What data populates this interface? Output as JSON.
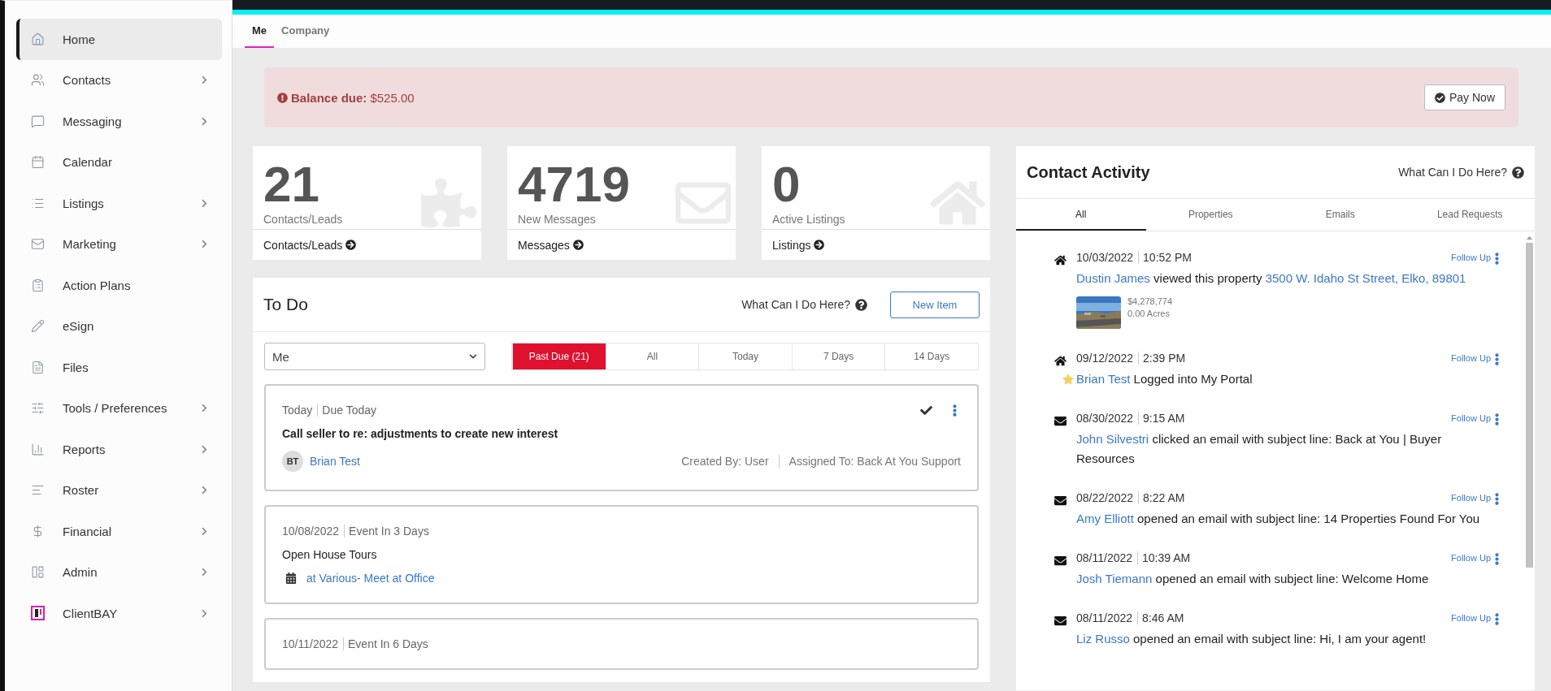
{
  "sidebar": {
    "items": [
      {
        "label": "Home",
        "selected": true,
        "has_submenu": false
      },
      {
        "label": "Contacts",
        "selected": false,
        "has_submenu": true
      },
      {
        "label": "Messaging",
        "selected": false,
        "has_submenu": true
      },
      {
        "label": "Calendar",
        "selected": false,
        "has_submenu": false
      },
      {
        "label": "Listings",
        "selected": false,
        "has_submenu": true
      },
      {
        "label": "Marketing",
        "selected": false,
        "has_submenu": true
      },
      {
        "label": "Action Plans",
        "selected": false,
        "has_submenu": false
      },
      {
        "label": "eSign",
        "selected": false,
        "has_submenu": false
      },
      {
        "label": "Files",
        "selected": false,
        "has_submenu": false
      },
      {
        "label": "Tools / Preferences",
        "selected": false,
        "has_submenu": true
      },
      {
        "label": "Reports",
        "selected": false,
        "has_submenu": true
      },
      {
        "label": "Roster",
        "selected": false,
        "has_submenu": true
      },
      {
        "label": "Financial",
        "selected": false,
        "has_submenu": true
      },
      {
        "label": "Admin",
        "selected": false,
        "has_submenu": true
      },
      {
        "label": "ClientBAY",
        "selected": false,
        "has_submenu": true
      }
    ]
  },
  "top_tabs": [
    {
      "label": "Me",
      "selected": true
    },
    {
      "label": "Company",
      "selected": false
    }
  ],
  "balance_banner": {
    "label": "Balance due:",
    "amount": "$525.00",
    "button": "Pay Now"
  },
  "stats": [
    {
      "kind": "puzzle",
      "value": "21",
      "label": "Contacts/Leads",
      "link": "Contacts/Leads"
    },
    {
      "kind": "mail",
      "value": "4719",
      "label": "New Messages",
      "link": "Messages"
    },
    {
      "kind": "house",
      "value": "0",
      "label": "Active Listings",
      "link": "Listings"
    }
  ],
  "todo": {
    "title": "To Do",
    "help": "What Can I Do Here?",
    "new_button": "New Item",
    "assignee": "Me",
    "filters": [
      {
        "label": "Past Due (21)",
        "selected": true
      },
      {
        "label": "All",
        "selected": false
      },
      {
        "label": "Today",
        "selected": false
      },
      {
        "label": "7 Days",
        "selected": false
      },
      {
        "label": "14 Days",
        "selected": false
      }
    ],
    "items": [
      {
        "kind": "task",
        "date": "Today",
        "status": "Due Today",
        "title": "Call seller to re: adjustments to create new interest",
        "contact_initials": "BT",
        "contact": "Brian Test",
        "created_by": "Created By: User",
        "assigned_to": "Assigned To: Back At You Support"
      },
      {
        "kind": "event",
        "date": "10/08/2022",
        "status": "Event In 3 Days",
        "title": "Open House Tours",
        "location": "at Various- Meet at Office"
      },
      {
        "kind": "event",
        "date": "10/11/2022",
        "status": "Event In 6 Days"
      }
    ]
  },
  "contact_activity": {
    "title": "Contact Activity",
    "help": "What Can I Do Here?",
    "tabs": [
      {
        "label": "All",
        "selected": true
      },
      {
        "label": "Properties",
        "selected": false
      },
      {
        "label": "Emails",
        "selected": false
      },
      {
        "label": "Lead Requests",
        "selected": false
      }
    ],
    "items": [
      {
        "kind": "property",
        "date": "10/03/2022",
        "time": "10:52 PM",
        "name": "Dustin James",
        "text": "viewed this property",
        "address": "3500 W. Idaho St Street, Elko, 89801",
        "price": "$4,278,774",
        "acres": "0.00 Acres",
        "starred": false,
        "action": "Follow Up"
      },
      {
        "kind": "property",
        "date": "09/12/2022",
        "time": "2:39 PM",
        "name": "Brian Test",
        "text": "Logged into My Portal",
        "starred": true,
        "action": "Follow Up"
      },
      {
        "kind": "email",
        "date": "08/30/2022",
        "time": "9:15 AM",
        "name": "John Silvestri",
        "text": "clicked an email with subject line: Back at You | Buyer Resources",
        "starred": false,
        "action": "Follow Up"
      },
      {
        "kind": "email",
        "date": "08/22/2022",
        "time": "8:22 AM",
        "name": "Amy Elliott",
        "text": "opened an email with subject line: 14 Properties Found For You",
        "starred": false,
        "action": "Follow Up"
      },
      {
        "kind": "email",
        "date": "08/11/2022",
        "time": "10:39 AM",
        "name": "Josh Tiemann",
        "text": "opened an email with subject line: Welcome Home",
        "starred": false,
        "action": "Follow Up"
      },
      {
        "kind": "email",
        "date": "08/11/2022",
        "time": "8:46 AM",
        "name": "Liz Russo",
        "text": "opened an email with subject line: Hi, I am your agent!",
        "starred": false,
        "action": "Follow Up"
      }
    ]
  }
}
